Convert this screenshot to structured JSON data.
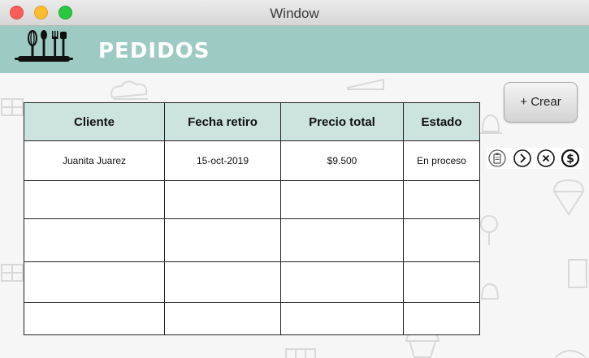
{
  "window": {
    "title": "Window"
  },
  "header": {
    "title": "PEDIDOS",
    "logo": "kitchen-utensils-logo"
  },
  "toolbar": {
    "create_label": "+ Crear"
  },
  "table": {
    "columns": [
      "Cliente",
      "Fecha retiro",
      "Precio total",
      "Estado"
    ],
    "rows": [
      [
        "Juanita Juarez",
        "15-oct-2019",
        "$9.500",
        "En proceso"
      ],
      [
        "",
        "",
        "",
        ""
      ],
      [
        "",
        "",
        "",
        ""
      ],
      [
        "",
        "",
        "",
        ""
      ],
      [
        "",
        "",
        "",
        ""
      ]
    ]
  },
  "row_actions": {
    "icons": [
      "clipboard-icon",
      "chevron-right-icon",
      "close-icon",
      "dollar-icon"
    ]
  },
  "colors": {
    "header_bg": "#9dcac3",
    "table_header_bg": "#cde3df",
    "window_bg": "#f6f6f6"
  }
}
